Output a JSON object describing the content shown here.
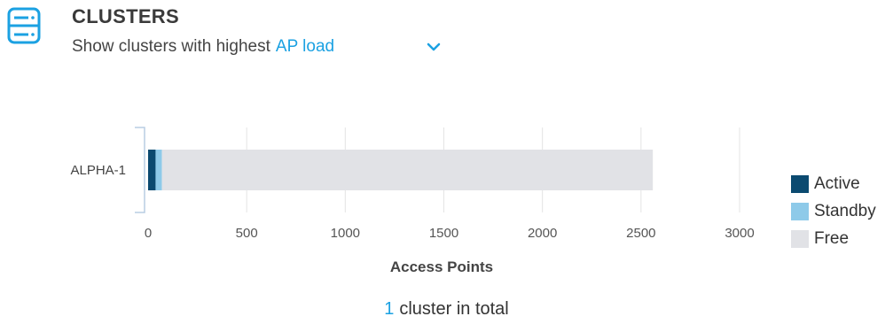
{
  "header": {
    "title": "CLUSTERS",
    "subtitle_prefix": "Show clusters with highest",
    "metric": "AP load",
    "icon": "server-icon"
  },
  "chart_data": {
    "type": "bar",
    "orientation": "horizontal",
    "stacked": true,
    "categories": [
      "ALPHA-1"
    ],
    "series": [
      {
        "name": "Active",
        "values": [
          38
        ],
        "color": "#0b4a70"
      },
      {
        "name": "Standby",
        "values": [
          32
        ],
        "color": "#8ecae9"
      },
      {
        "name": "Free",
        "values": [
          2490
        ],
        "color": "#e1e2e6"
      }
    ],
    "xlabel": "Access Points",
    "xticks": [
      0,
      500,
      1000,
      1500,
      2000,
      2500,
      3000
    ],
    "xlim": [
      0,
      3000
    ],
    "grid": true,
    "legend": "right"
  },
  "footer": {
    "count": "1",
    "text": "cluster in total"
  }
}
